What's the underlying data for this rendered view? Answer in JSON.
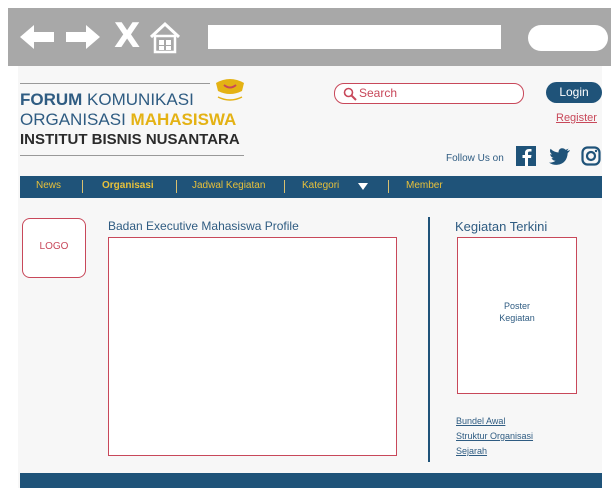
{
  "browser": {
    "back_icon": "left-arrow-icon",
    "forward_icon": "right-arrow-icon",
    "close_label": "X",
    "home_icon": "home-icon"
  },
  "brand": {
    "line1_bold": "FORUM",
    "line1_rest": " KOMUNIKASI",
    "line2_plain": "ORGANISASI ",
    "line2_gold": "MAHASISWA",
    "line3": "INSTITUT BISNIS NUSANTARA",
    "colors": {
      "primary": "#2f5c82",
      "gold": "#e4b214",
      "accent": "#c8485a",
      "nav": "#1f5379"
    }
  },
  "header": {
    "search_placeholder": "Search",
    "login_label": "Login",
    "register_label": "Register",
    "follow_label": "Follow Us on",
    "social_icons": [
      "facebook-icon",
      "twitter-icon",
      "instagram-icon"
    ]
  },
  "nav": {
    "items": [
      "News",
      "Organisasi",
      "Jadwal Kegiatan",
      "Kategori",
      "Member"
    ]
  },
  "main": {
    "logo_label": "LOGO",
    "profile_title": "Badan Executive Mahasiswa Profile"
  },
  "aside": {
    "title": "Kegiatan Terkini",
    "poster_line1": "Poster",
    "poster_line2": "Kegiatan",
    "links": [
      "Bundel Awal",
      "Struktur Organisasi",
      "Sejarah"
    ]
  }
}
